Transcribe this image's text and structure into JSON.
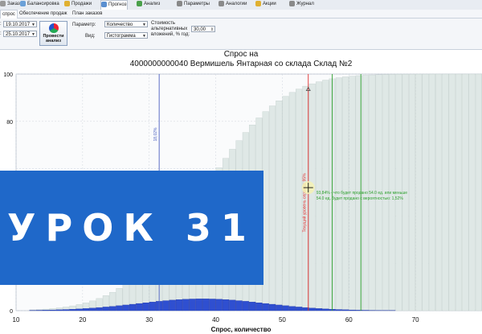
{
  "top_tabs": [
    {
      "label": "Заказ",
      "icon": "order-icon",
      "color": "#999999"
    },
    {
      "label": "Балансировка",
      "icon": "balance-icon",
      "color": "#6aa0d8"
    },
    {
      "label": "Продажи",
      "icon": "sales-icon",
      "color": "#e0b030"
    },
    {
      "label": "Прогноз",
      "icon": "forecast-icon",
      "color": "#5a8fd0"
    },
    {
      "label": "Анализ",
      "icon": "analysis-icon",
      "color": "#4aa04a"
    },
    {
      "label": "Параметры",
      "icon": "params-icon",
      "color": "#888888"
    },
    {
      "label": "Аналогии",
      "icon": "analogs-icon",
      "color": "#8a8a8a"
    },
    {
      "label": "Акции",
      "icon": "promo-icon",
      "color": "#e0b030"
    },
    {
      "label": "Журнал",
      "icon": "journal-icon",
      "color": "#8a8a8a"
    }
  ],
  "sub_tabs": [
    "спрос",
    "Обеспечение продаж",
    "План заказов"
  ],
  "toolbar": {
    "date_from": "19.10.2017",
    "date_to": "25.10.2017",
    "run_label_1": "Провести",
    "run_label_2": "анализ",
    "param_label": "Параметр:",
    "param_value": "Количество",
    "view_label": "Вид:",
    "view_value": "Гистограмма",
    "alt_cost_label_1": "Стоимость",
    "alt_cost_label_2": "альтернативных",
    "alt_cost_label_3": "вложений, % год:",
    "alt_cost_value": "30,00"
  },
  "overlay_text": "УРОК 31",
  "colors": {
    "accent": "#1f68c9",
    "cum_bar": "#dfe8e6",
    "pdf_bar": "#2f4fd0",
    "level_line": "#e03030",
    "quantile_line": "#2ea02e",
    "mean_line": "#4a5fc0"
  },
  "chart_data": {
    "type": "bar",
    "title_line1": "Спрос на",
    "title_line2": "4000000000040 Вермишель Янтарная со склада Склад №2",
    "xlabel": "Спрос, количество",
    "ylabel": "",
    "xlim": [
      10,
      80
    ],
    "ylim": [
      0,
      100
    ],
    "x_ticks": [
      10,
      20,
      30,
      40,
      50,
      60,
      70
    ],
    "y_ticks": [
      0,
      20,
      40,
      60,
      80,
      100
    ],
    "y_tick_labels": [
      "0",
      "",
      "",
      "",
      "80",
      "100"
    ],
    "grid": true,
    "series": [
      {
        "name": "cumulative",
        "kind": "cdf",
        "mean": 38,
        "sd": 9.5
      },
      {
        "name": "density",
        "kind": "pdf",
        "mean": 38,
        "sd": 9.5,
        "peak": 5.0
      }
    ],
    "markers": [
      {
        "x": 31.5,
        "label": "18,02%",
        "color": "#4a5fc0"
      },
      {
        "x": 53.9,
        "label": "Текущий уровень сервиса: 95%",
        "color": "#e03030"
      },
      {
        "x": 57.5,
        "label": "",
        "color": "#2ea02e"
      },
      {
        "x": 61.8,
        "label": "",
        "color": "#2ea02e"
      }
    ],
    "annotations": [
      {
        "text": "93,84% - что будет продано 54.0 ед. или меньше"
      },
      {
        "text": "54.0 ед. будет продано с вероятностью: 1,52%"
      }
    ],
    "cursor_x": 53.9,
    "cursor_y": 52
  }
}
